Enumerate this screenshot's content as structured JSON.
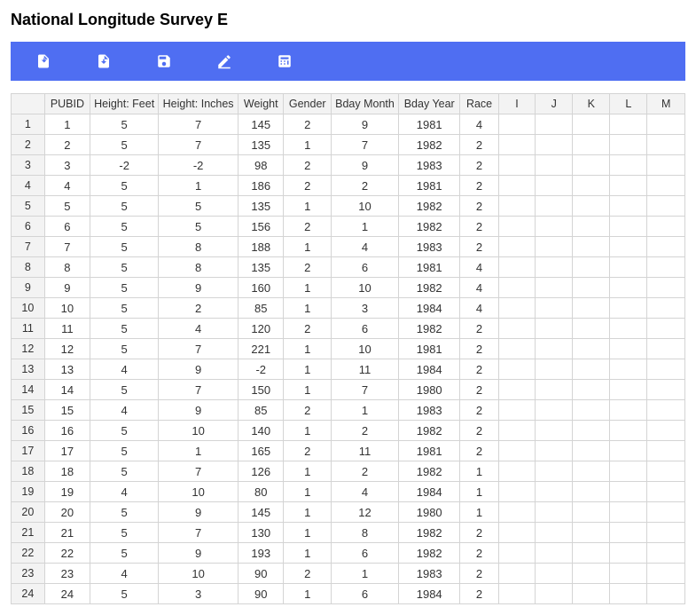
{
  "title": "National Longitude Survey E",
  "toolbar": {
    "icons": [
      "import-icon",
      "download-icon",
      "save-icon",
      "edit-icon",
      "calculator-icon"
    ]
  },
  "columns": [
    "PUBID",
    "Height: Feet",
    "Height: Inches",
    "Weight",
    "Gender",
    "Bday Month",
    "Bday Year",
    "Race"
  ],
  "extraColumns": [
    "I",
    "J",
    "K",
    "L",
    "M"
  ],
  "rows": [
    [
      1,
      5,
      7,
      145,
      2,
      9,
      1981,
      4
    ],
    [
      2,
      5,
      7,
      135,
      1,
      7,
      1982,
      2
    ],
    [
      3,
      -2,
      -2,
      98,
      2,
      9,
      1983,
      2
    ],
    [
      4,
      5,
      1,
      186,
      2,
      2,
      1981,
      2
    ],
    [
      5,
      5,
      5,
      135,
      1,
      10,
      1982,
      2
    ],
    [
      6,
      5,
      5,
      156,
      2,
      1,
      1982,
      2
    ],
    [
      7,
      5,
      8,
      188,
      1,
      4,
      1983,
      2
    ],
    [
      8,
      5,
      8,
      135,
      2,
      6,
      1981,
      4
    ],
    [
      9,
      5,
      9,
      160,
      1,
      10,
      1982,
      4
    ],
    [
      10,
      5,
      2,
      85,
      1,
      3,
      1984,
      4
    ],
    [
      11,
      5,
      4,
      120,
      2,
      6,
      1982,
      2
    ],
    [
      12,
      5,
      7,
      221,
      1,
      10,
      1981,
      2
    ],
    [
      13,
      4,
      9,
      -2,
      1,
      11,
      1984,
      2
    ],
    [
      14,
      5,
      7,
      150,
      1,
      7,
      1980,
      2
    ],
    [
      15,
      4,
      9,
      85,
      2,
      1,
      1983,
      2
    ],
    [
      16,
      5,
      10,
      140,
      1,
      2,
      1982,
      2
    ],
    [
      17,
      5,
      1,
      165,
      2,
      11,
      1981,
      2
    ],
    [
      18,
      5,
      7,
      126,
      1,
      2,
      1982,
      1
    ],
    [
      19,
      4,
      10,
      80,
      1,
      4,
      1984,
      1
    ],
    [
      20,
      5,
      9,
      145,
      1,
      12,
      1980,
      1
    ],
    [
      21,
      5,
      7,
      130,
      1,
      8,
      1982,
      2
    ],
    [
      22,
      5,
      9,
      193,
      1,
      6,
      1982,
      2
    ],
    [
      23,
      4,
      10,
      90,
      2,
      1,
      1983,
      2
    ],
    [
      24,
      5,
      3,
      90,
      1,
      6,
      1984,
      2
    ]
  ]
}
